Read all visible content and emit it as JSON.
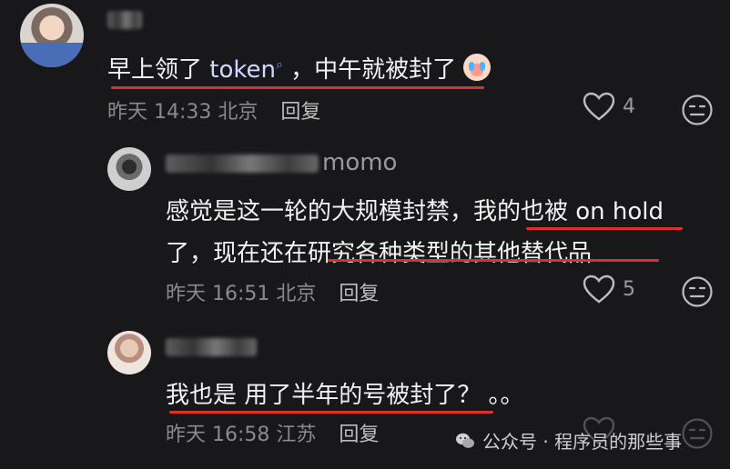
{
  "comments": [
    {
      "username": "",
      "text_prefix": "早上领了 ",
      "token_text": "token",
      "search_mark": "⌕",
      "text_suffix": " ，中午就被封了",
      "emoji": "crying-face-emoji",
      "time": "昨天 14:33",
      "location": "北京",
      "reply": "回复",
      "likes": "4"
    },
    {
      "username": "momo",
      "line1": "感觉是这一轮的大规模封禁，我的也被 on hold",
      "line2": "了，现在还在研究各种类型的其他替代品",
      "time": "昨天 16:51",
      "location": "北京",
      "reply": "回复",
      "likes": "5"
    },
    {
      "username": "",
      "text": "我也是 用了半年的号被封了？ 。。",
      "time": "昨天 16:58",
      "location": "江苏",
      "reply": "回复"
    }
  ],
  "watermark": "公众号 · 程序员的那些事",
  "colors": {
    "underline": "#e0302e",
    "token": "#cfd8ff",
    "background": "#18181b"
  },
  "icons": [
    "heart-icon",
    "comment-face-icon",
    "wechat-icon"
  ]
}
